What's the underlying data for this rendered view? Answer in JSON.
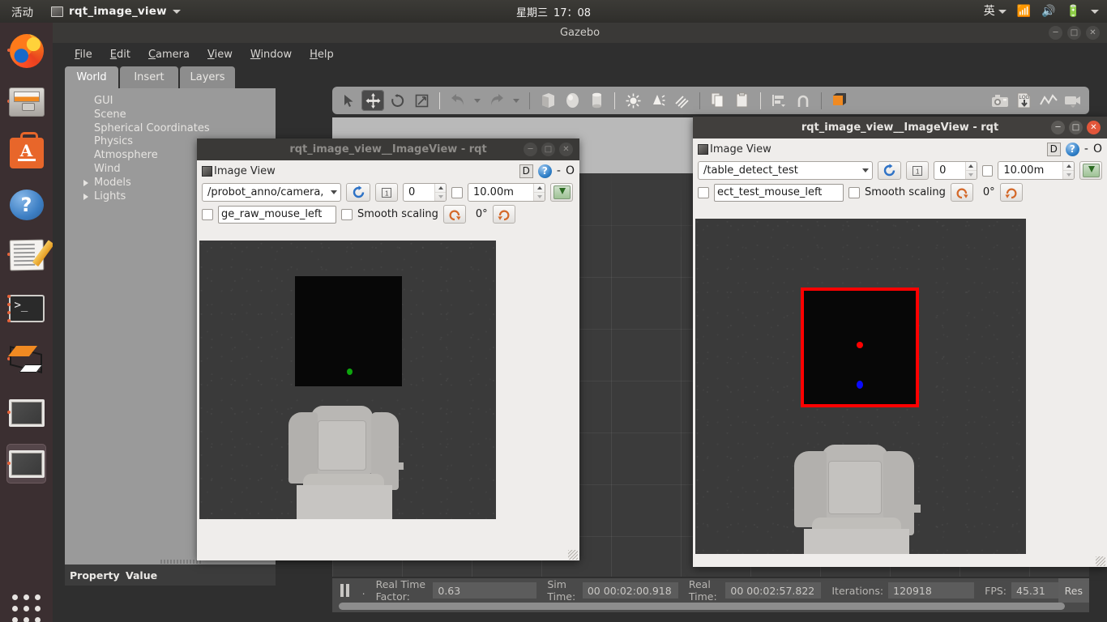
{
  "topbar": {
    "activities": "活动",
    "app_name": "rqt_image_view",
    "app_icon": "window-icon",
    "day": "星期三",
    "time": "17：08",
    "input_method": "英",
    "icons": [
      "wifi-icon",
      "volume-icon",
      "battery-icon",
      "chevron-down-icon"
    ]
  },
  "launcher": {
    "items": [
      {
        "name": "firefox",
        "running": true,
        "selected": false
      },
      {
        "name": "files",
        "running": true,
        "selected": false
      },
      {
        "name": "ubuntu-software",
        "running": false,
        "selected": false
      },
      {
        "name": "help",
        "running": false,
        "selected": false
      },
      {
        "name": "text-editor",
        "running": true,
        "selected": false
      },
      {
        "name": "terminal",
        "running": true,
        "selected": false
      },
      {
        "name": "gazebo",
        "running": true,
        "selected": false
      },
      {
        "name": "rqt-image-view-1",
        "running": true,
        "selected": false
      },
      {
        "name": "rqt-image-view-2",
        "running": true,
        "selected": true
      }
    ],
    "apps_grid": "show-applications"
  },
  "gazebo": {
    "title": "Gazebo",
    "window_buttons": [
      "minimize",
      "maximize",
      "close"
    ],
    "menu": [
      {
        "label": "File",
        "mnemonic": "F"
      },
      {
        "label": "Edit",
        "mnemonic": "E"
      },
      {
        "label": "Camera",
        "mnemonic": "C"
      },
      {
        "label": "View",
        "mnemonic": "V"
      },
      {
        "label": "Window",
        "mnemonic": "W"
      },
      {
        "label": "Help",
        "mnemonic": "H"
      }
    ],
    "tabs": [
      {
        "label": "World",
        "active": true
      },
      {
        "label": "Insert",
        "active": false
      },
      {
        "label": "Layers",
        "active": false
      }
    ],
    "tree": [
      {
        "label": "GUI",
        "expandable": false
      },
      {
        "label": "Scene",
        "expandable": false
      },
      {
        "label": "Spherical Coordinates",
        "expandable": false
      },
      {
        "label": "Physics",
        "expandable": false
      },
      {
        "label": "Atmosphere",
        "expandable": false
      },
      {
        "label": "Wind",
        "expandable": false
      },
      {
        "label": "Models",
        "expandable": true
      },
      {
        "label": "Lights",
        "expandable": true
      }
    ],
    "property_header": {
      "property": "Property",
      "value": "Value"
    },
    "toolbar_left": [
      {
        "name": "select-arrow-icon",
        "active": false
      },
      {
        "name": "translate-move-icon",
        "active": true
      },
      {
        "name": "rotate-icon",
        "active": false
      },
      {
        "name": "scale-icon",
        "active": false
      },
      {
        "name": "undo-icon",
        "active": false
      },
      {
        "name": "undo-dropdown-icon",
        "active": false
      },
      {
        "name": "redo-icon",
        "active": false
      },
      {
        "name": "redo-dropdown-icon",
        "active": false
      },
      {
        "name": "box-icon",
        "active": false
      },
      {
        "name": "sphere-icon",
        "active": false
      },
      {
        "name": "cylinder-icon",
        "active": false
      },
      {
        "name": "point-light-icon",
        "active": false
      },
      {
        "name": "spot-light-icon",
        "active": false
      },
      {
        "name": "directional-light-icon",
        "active": false
      },
      {
        "name": "copy-icon",
        "active": false
      },
      {
        "name": "paste-icon",
        "active": false
      },
      {
        "name": "align-icon",
        "active": false
      },
      {
        "name": "snap-icon",
        "active": false
      },
      {
        "name": "view-angle-icon",
        "active": false
      }
    ],
    "toolbar_right": [
      {
        "name": "screenshot-camera-icon"
      },
      {
        "name": "log-record-icon"
      },
      {
        "name": "plot-icon"
      },
      {
        "name": "video-record-icon"
      }
    ],
    "status": {
      "pause_button": "pause-icon",
      "dot": ".",
      "real_time_factor_label": "Real Time Factor:",
      "real_time_factor_value": "0.63",
      "sim_time_label": "Sim Time:",
      "sim_time_value": "00 00:02:00.918",
      "real_time_label": "Real Time:",
      "real_time_value": "00 00:02:57.822",
      "iterations_label": "Iterations:",
      "iterations_value": "120918",
      "fps_label": "FPS:",
      "fps_value": "45.31",
      "reset_label": "Res"
    }
  },
  "rqt_left": {
    "title": "rqt_image_view__ImageView - rqt",
    "window_buttons": [
      "minimize",
      "maximize",
      "close"
    ],
    "panel_title": "Image View",
    "panel_icon": "panel-icon",
    "dock_label": "D",
    "help_label": "?",
    "minimize_label": "-",
    "close_label": "O",
    "topic": "/probot_anno/camera,",
    "refresh_icon": "refresh-icon",
    "numbered_icon": "1",
    "index_value": "0",
    "max_depth_checkbox": false,
    "max_depth_value": "10.00m",
    "save_icon": "save-image-icon",
    "publish_checkbox": false,
    "publish_topic": "ge_raw_mouse_left",
    "smooth_scaling_checkbox": false,
    "smooth_scaling_label": "Smooth scaling",
    "rotate_ccw_icon": "rotate-ccw-icon",
    "rotation_value": "0°",
    "rotate_cw_icon": "rotate-cw-icon"
  },
  "rqt_right": {
    "title": "rqt_image_view__ImageView - rqt",
    "window_buttons": [
      "minimize",
      "maximize",
      "close"
    ],
    "panel_title": "Image View",
    "panel_icon": "panel-icon",
    "dock_label": "D",
    "help_label": "?",
    "minimize_label": "-",
    "close_label": "O",
    "topic": "/table_detect_test",
    "refresh_icon": "refresh-icon",
    "numbered_icon": "1",
    "index_value": "0",
    "max_depth_checkbox": false,
    "max_depth_value": "10.00m",
    "save_icon": "save-image-icon",
    "publish_checkbox": false,
    "publish_topic": "ect_test_mouse_left",
    "smooth_scaling_checkbox": false,
    "smooth_scaling_label": "Smooth scaling",
    "rotate_ccw_icon": "rotate-ccw-icon",
    "rotation_value": "0°",
    "rotate_cw_icon": "rotate-cw-icon"
  },
  "colors": {
    "accent_orange": "#e8662a",
    "detection_box": "#ff0000",
    "marker_red": "#ff0000",
    "marker_blue": "#0000ff",
    "marker_green": "#00a000",
    "axis_blue": "#2326e0"
  }
}
